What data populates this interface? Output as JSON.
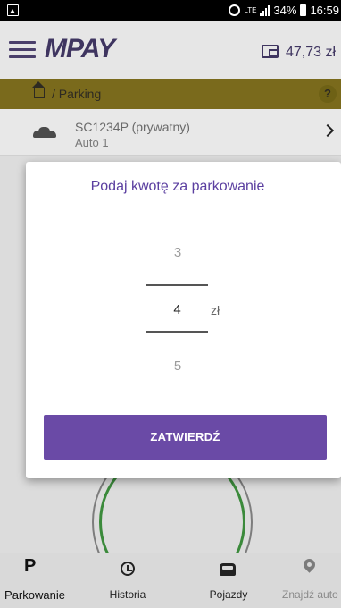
{
  "status_bar": {
    "network": "LTE",
    "battery": "34%",
    "time": "16:59"
  },
  "header": {
    "logo": "MPAY",
    "balance": "47,73 zł"
  },
  "breadcrumb": {
    "path": "/ Parking",
    "help": "?"
  },
  "vehicle": {
    "plate": "SC1234P (prywatny)",
    "name": "Auto 1"
  },
  "dialog": {
    "title": "Podaj kwotę za parkowanie",
    "picker": {
      "previous": "3",
      "current": "4",
      "next": "5",
      "unit": "zł"
    },
    "confirm_label": "ZATWIERDŹ"
  },
  "bottom_nav": {
    "items": [
      {
        "label": "Parkowanie",
        "icon": "parking-icon",
        "active": true
      },
      {
        "label": "Historia",
        "icon": "history-icon"
      },
      {
        "label": "Pojazdy",
        "icon": "car-icon"
      },
      {
        "label": "Znajdź auto",
        "icon": "location-pin-icon"
      }
    ]
  },
  "colors": {
    "accent": "#6a4aa6",
    "title": "#5b3fa0",
    "breadcrumb_bar": "#f0d23a"
  }
}
